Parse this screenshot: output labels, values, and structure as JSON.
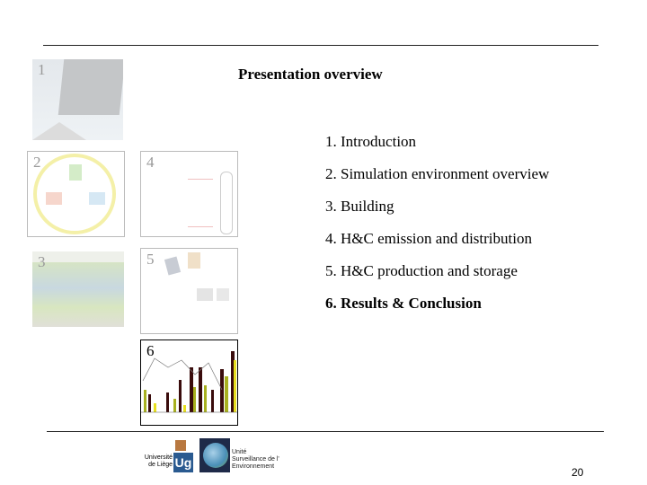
{
  "title": "Presentation overview",
  "agenda": [
    "1. Introduction",
    "2. Simulation environment overview",
    "3. Building",
    "4. H&C emission and distribution",
    "5. H&C production and storage",
    "6. Results & Conclusion"
  ],
  "active_item_index": 5,
  "thumbnails": [
    "1",
    "2",
    "3",
    "4",
    "5",
    "6"
  ],
  "footer": {
    "university": [
      "Université",
      "de Liège"
    ],
    "unit": [
      "Unité",
      "Surveillance de l'",
      "Environnement"
    ],
    "page_number": "20"
  }
}
